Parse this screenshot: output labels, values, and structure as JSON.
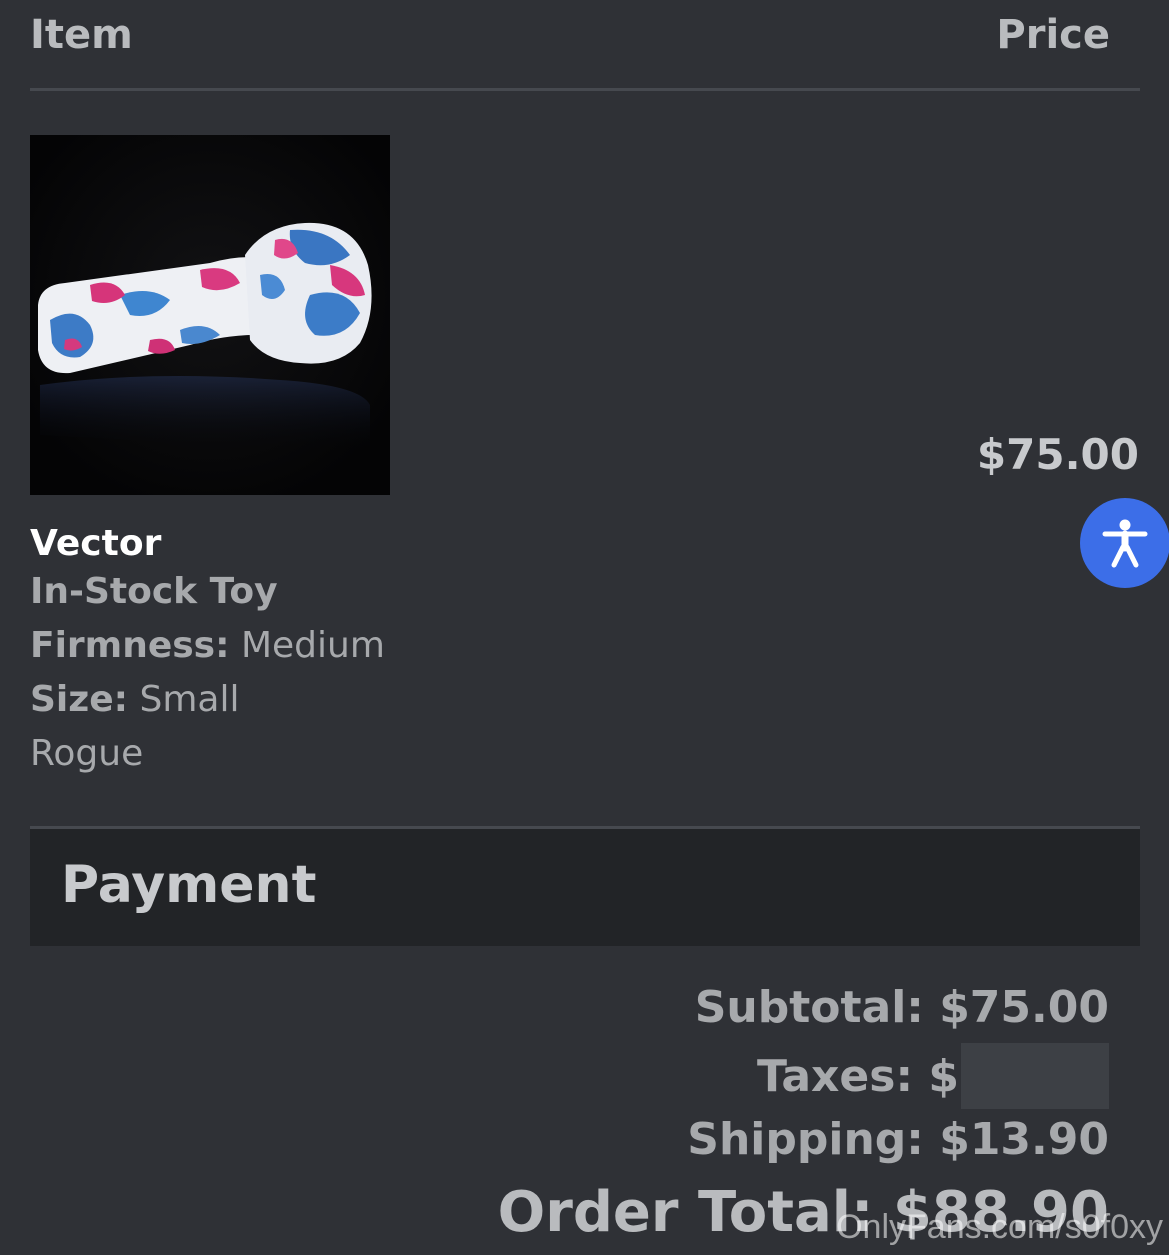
{
  "table_header": {
    "item_label": "Item",
    "price_label": "Price"
  },
  "line_item": {
    "name": "Vector",
    "type": "In-Stock Toy",
    "firmness_label": "Firmness:",
    "firmness_value": "Medium",
    "size_label": "Size:",
    "size_value": "Small",
    "color_value": "Rogue",
    "price": "$75.00"
  },
  "payment": {
    "title": "Payment",
    "subtotal": "Subtotal: $75.00",
    "taxes_prefix": "Taxes: $",
    "shipping": "Shipping: $13.90",
    "order_total": "Order Total: $88.90"
  },
  "watermark": "OnlyFans.com/s0f0xy",
  "icons": {
    "accessibility": "accessibility-person-icon"
  },
  "colors": {
    "background": "#2f3136",
    "accent_button": "#3c6ee8",
    "payment_header_bg": "#222427"
  }
}
